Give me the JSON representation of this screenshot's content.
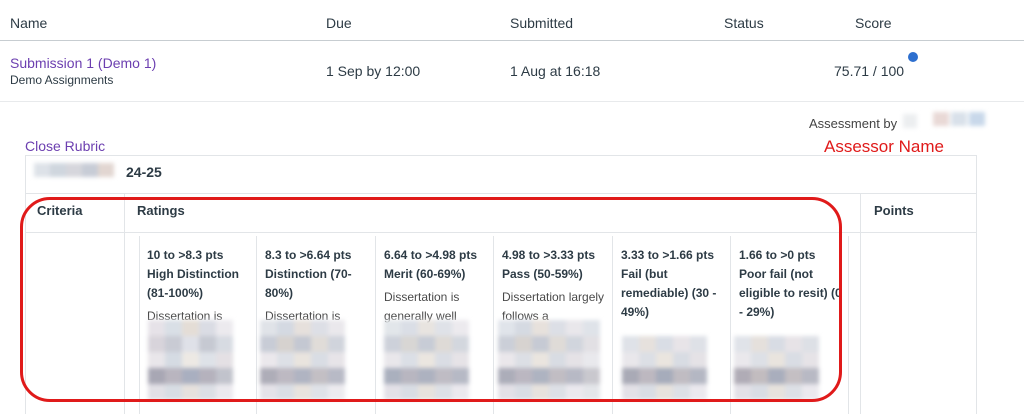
{
  "table": {
    "headers": {
      "name": "Name",
      "due": "Due",
      "submitted": "Submitted",
      "status": "Status",
      "score": "Score"
    },
    "row": {
      "title": "Submission 1 (Demo 1)",
      "group": "Demo Assignments",
      "due": "1 Sep by 12:00",
      "submitted": "1 Aug at 16:18",
      "status": "",
      "score": "75.71 / 100"
    }
  },
  "assessment": {
    "label": "Assessment by",
    "annotation": "Assessor Name",
    "annotation_color": "#e01a1a"
  },
  "rubric": {
    "close_label": "Close Rubric",
    "title_suffix": "24-25",
    "columns": {
      "criteria": "Criteria",
      "ratings": "Ratings",
      "points": "Points"
    },
    "ratings": [
      {
        "pts": "10 to >8.3 pts",
        "name": "High Distinction (81-100%)",
        "desc": "Dissertation is"
      },
      {
        "pts": "8.3 to >6.64 pts",
        "name": "Distinction (70-80%)",
        "desc": "Dissertation is"
      },
      {
        "pts": "6.64 to >4.98 pts",
        "name": "Merit (60-69%)",
        "desc": "Dissertation is generally well"
      },
      {
        "pts": "4.98 to >3.33 pts",
        "name": "Pass (50-59%)",
        "desc": "Dissertation largely follows a"
      },
      {
        "pts": "3.33 to >1.66 pts",
        "name": "Fail (but remediable) (30 - 49%)",
        "desc": ""
      },
      {
        "pts": "1.66 to >0 pts",
        "name": "Poor fail (not eligible to resit) (0 - 29%)",
        "desc": ""
      }
    ]
  },
  "colors": {
    "link": "#6c3fb0",
    "dot": "#2d6fcf",
    "highlight_border": "#e01a1a"
  }
}
